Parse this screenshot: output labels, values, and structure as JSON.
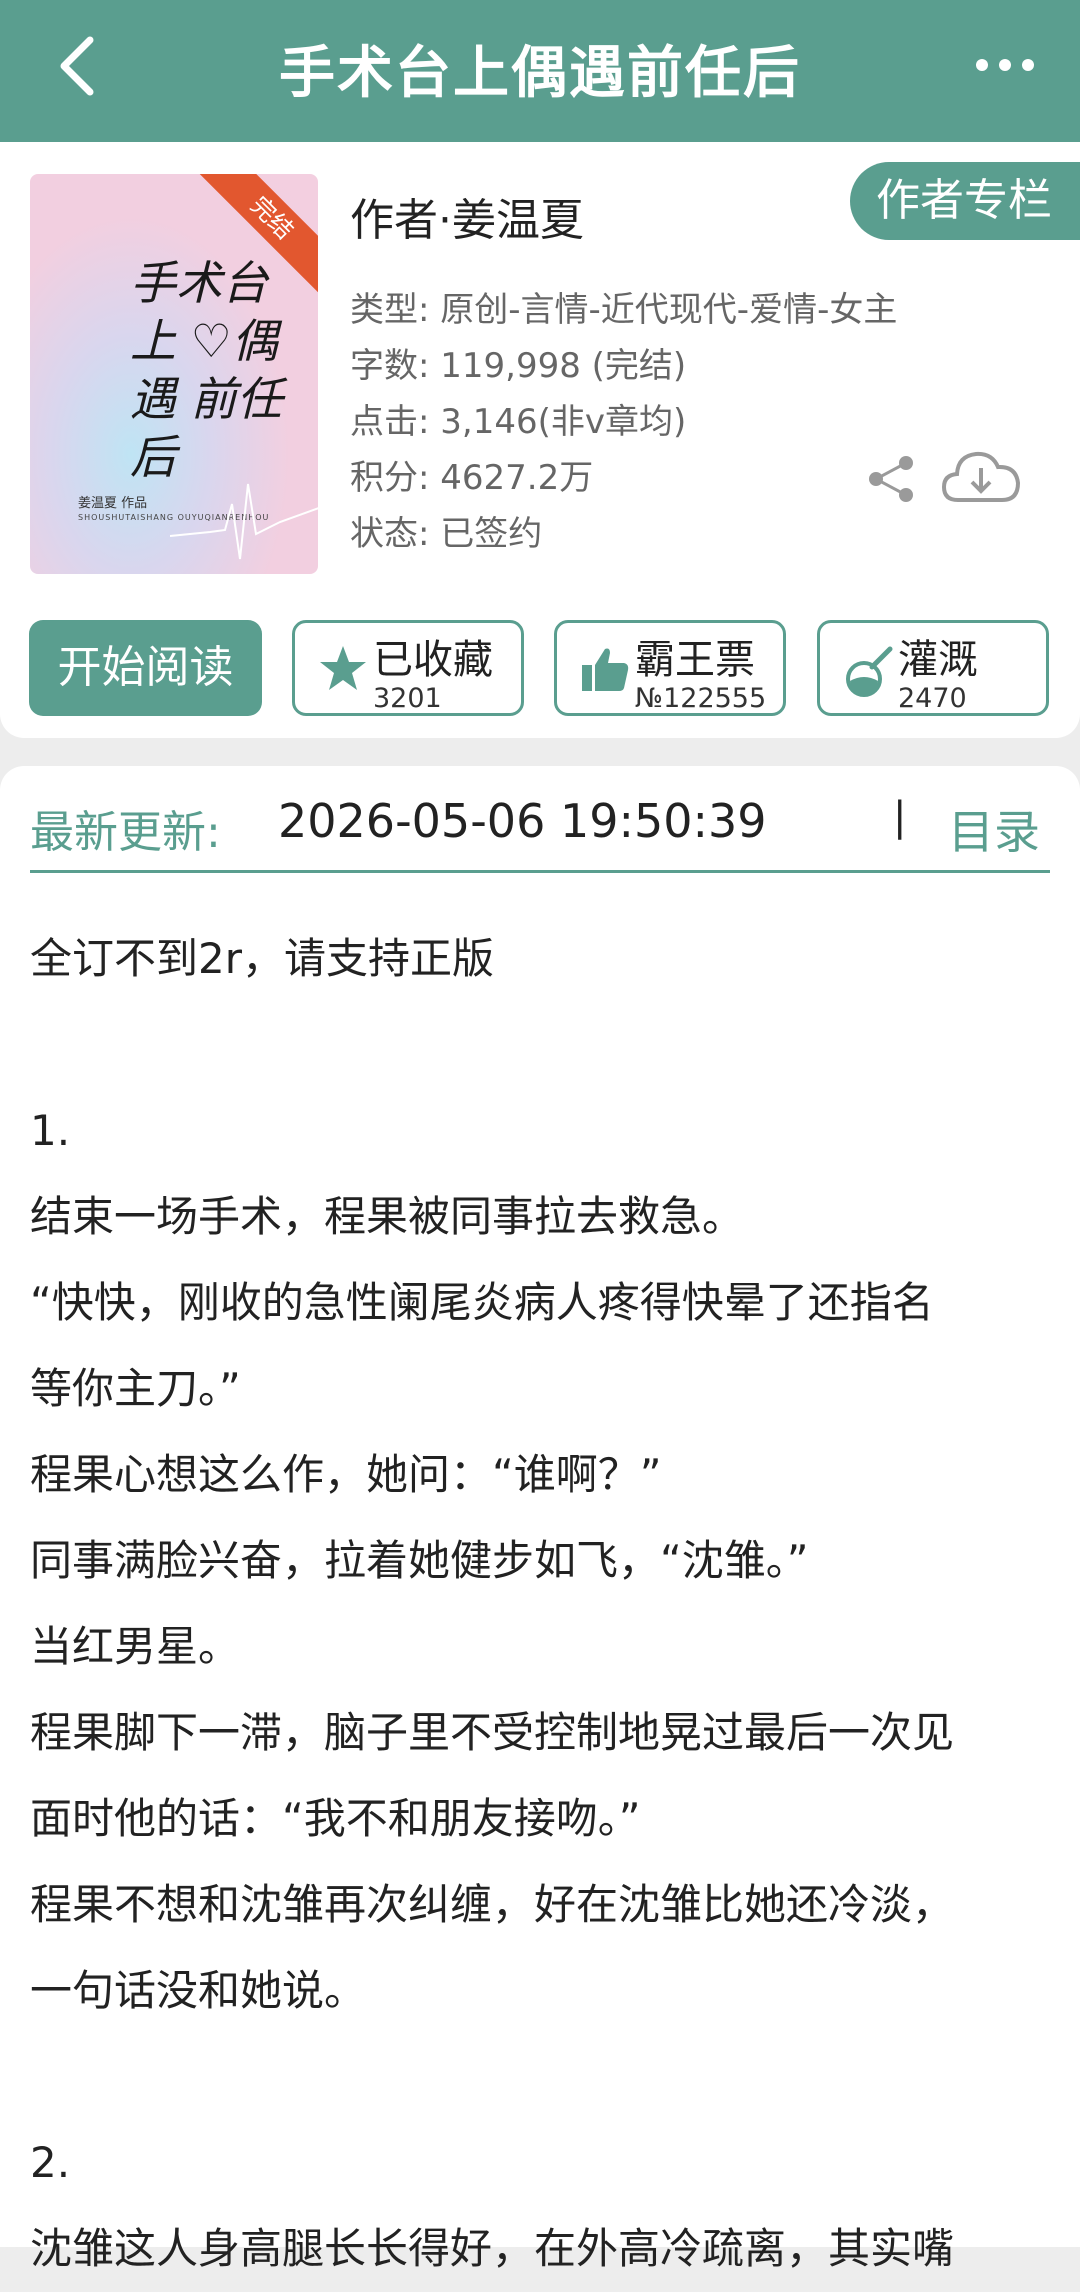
{
  "header": {
    "title": "手术台上偶遇前任后"
  },
  "book": {
    "cover": {
      "ribbon": "完结",
      "title_art": "手术台上 ♡偶遇 前任后",
      "author_tag": "姜温夏 作品",
      "pinyin": "SHOUSHUTAISHANG OUYUQIANRENHOU"
    },
    "author_line": "作者·姜温夏",
    "author_column_label": "作者专栏",
    "meta": {
      "type": "类型: 原创-言情-近代现代-爱情-女主",
      "words": "字数: 119,998 (完结)",
      "clicks": "点击: 3,146(非v章均)",
      "score": "积分: 4627.2万",
      "status": "状态: 已签约"
    }
  },
  "actions": {
    "start_label": "开始阅读",
    "favorite": {
      "label": "已收藏",
      "count": "3201"
    },
    "ticket": {
      "label": "霸王票",
      "count": "№122555"
    },
    "nutrient": {
      "label": "灌溉",
      "count": "2470"
    }
  },
  "update": {
    "label": "最新更新:",
    "time": "2026-05-06 19:50:39",
    "separator": "|",
    "toc_label": "目录"
  },
  "content": {
    "paragraphs": [
      "全订不到2r，请支持正版",
      "",
      "1.",
      "结束一场手术，程果被同事拉去救急。",
      "“快快，刚收的急性阑尾炎病人疼得快晕了还指名",
      "等你主刀。”",
      "程果心想这么作，她问：“谁啊？”",
      "同事满脸兴奋，拉着她健步如飞，“沈雏。”",
      "当红男星。",
      "程果脚下一滞，脑子里不受控制地晃过最后一次见",
      "面时他的话：“我不和朋友接吻。”",
      "程果不想和沈雏再次纠缠，好在沈雏比她还冷淡，",
      "一句话没和她说。",
      "",
      "2.",
      "沈雏这人身高腿长长得好，在外高冷疏离，其实嘴"
    ]
  },
  "colors": {
    "accent": "#5a9e8f",
    "ribbon": "#e2572f"
  }
}
